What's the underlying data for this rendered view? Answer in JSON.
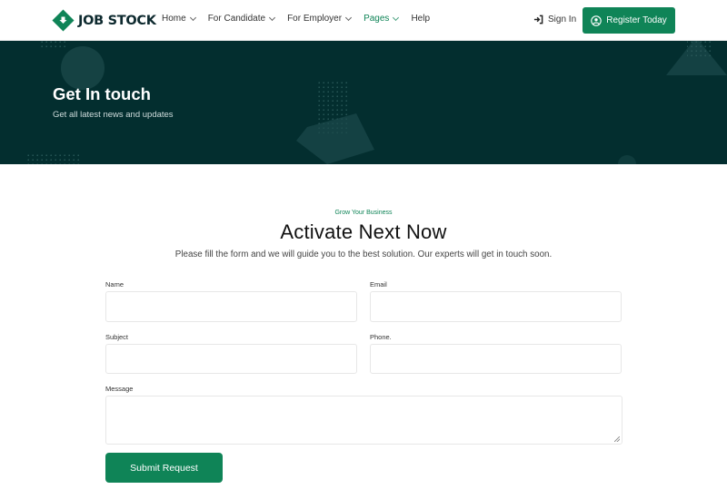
{
  "brand": {
    "name": "JOB STOCK",
    "accent": "#0f8457",
    "dark": "#032e2f"
  },
  "nav": {
    "items": [
      {
        "label": "Home",
        "dropdown": true,
        "active": false
      },
      {
        "label": "For Candidate",
        "dropdown": true,
        "active": false
      },
      {
        "label": "For Employer",
        "dropdown": true,
        "active": false
      },
      {
        "label": "Pages",
        "dropdown": true,
        "active": true
      },
      {
        "label": "Help",
        "dropdown": false,
        "active": false
      }
    ],
    "signin_label": "Sign In",
    "signin_icon": "sign-in-icon",
    "register_label": "Register Today",
    "register_icon": "user-circle-icon"
  },
  "hero": {
    "title": "Get In touch",
    "subtitle": "Get all latest news and updates"
  },
  "form_section": {
    "eyebrow": "Grow Your Business",
    "heading": "Activate Next Now",
    "lead": "Please fill the form and we will guide you to the best solution. Our experts will get in touch soon."
  },
  "form": {
    "name": {
      "label": "Name",
      "value": "",
      "placeholder": ""
    },
    "email": {
      "label": "Email",
      "value": "",
      "placeholder": ""
    },
    "subject": {
      "label": "Subject",
      "value": "",
      "placeholder": ""
    },
    "phone": {
      "label": "Phone.",
      "value": "",
      "placeholder": ""
    },
    "message": {
      "label": "Message",
      "value": "",
      "placeholder": ""
    },
    "submit_label": "Submit Request"
  }
}
